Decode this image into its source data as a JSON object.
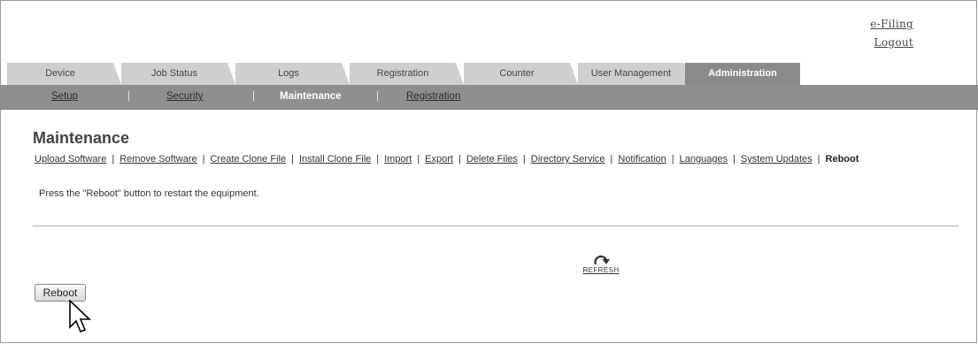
{
  "header": {
    "links": [
      "e-Filing",
      "Logout"
    ]
  },
  "tabs": [
    {
      "label": "Device"
    },
    {
      "label": "Job Status"
    },
    {
      "label": "Logs"
    },
    {
      "label": "Registration"
    },
    {
      "label": "Counter"
    },
    {
      "label": "User Management"
    },
    {
      "label": "Administration",
      "active": true
    }
  ],
  "submenu": {
    "items": [
      "Setup",
      "Security",
      "Maintenance",
      "Registration"
    ],
    "separator": "|",
    "current": "Maintenance"
  },
  "page": {
    "title": "Maintenance",
    "subnav": [
      "Upload Software",
      "Remove Software",
      "Create Clone File",
      "Install Clone File",
      "Import",
      "Export",
      "Delete Files",
      "Directory Service",
      "Notification",
      "Languages",
      "System Updates",
      "Reboot"
    ],
    "subnav_separator": "|",
    "subnav_current": "Reboot",
    "description": "Press the \"Reboot\" button to restart the equipment.",
    "refresh_label": "REFRESH",
    "refresh_icon": "refresh-icon",
    "reboot_button": "Reboot",
    "cursor_icon": "mouse-pointer-icon"
  },
  "colors": {
    "active_tab": "#8a8a8a",
    "inactive_tab": "#cfcfcf",
    "submenu_bar": "#8f8f8f"
  }
}
